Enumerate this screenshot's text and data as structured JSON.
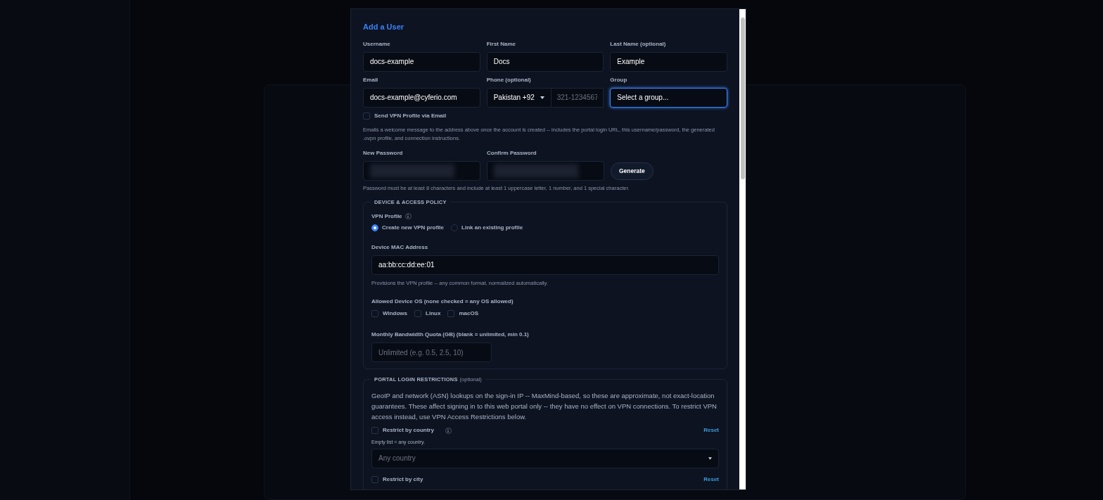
{
  "modal": {
    "title": "Add a User",
    "row1": [
      {
        "label": "Username",
        "value": "docs-example"
      },
      {
        "label": "First Name",
        "value": "Docs"
      },
      {
        "label": "Last Name (optional)",
        "value": "Example"
      }
    ],
    "email": {
      "label": "Email",
      "value": "docs-example@cyferio.com"
    },
    "phone": {
      "label": "Phone (optional)",
      "country": "Pakistan +92",
      "placeholder": "321-1234567"
    },
    "group": {
      "label": "Group",
      "value": "Select a group...",
      "focused": true
    },
    "send_email": {
      "label": "Send VPN Profile via Email",
      "checked": false,
      "help": "Emails a welcome message to the address above once the account is created -- includes the portal login URL, this username/password, the generated .ovpn profile, and connection instructions."
    },
    "passwords": [
      {
        "label": "New Password"
      },
      {
        "label": "Confirm Password"
      }
    ],
    "generate": "Generate",
    "password_help": "Password must be at least 8 characters and include at least 1 uppercase letter, 1 number, and 1 special character.",
    "device_policy": {
      "title": "DEVICE & ACCESS POLICY",
      "vpn_profile_label": "VPN Profile",
      "vpn_options": [
        {
          "label": "Create new VPN profile",
          "selected": true
        },
        {
          "label": "Link an existing profile",
          "selected": false
        }
      ],
      "mac": {
        "label": "Device MAC Address",
        "value": "aa:bb:cc:dd:ee:01",
        "help": "Provisions the VPN profile -- any common format, normalized automatically."
      },
      "os": {
        "label": "Allowed Device OS (none checked = any OS allowed)",
        "options": [
          {
            "label": "Windows",
            "checked": false
          },
          {
            "label": "Linux",
            "checked": false
          },
          {
            "label": "macOS",
            "checked": false
          }
        ]
      },
      "quota": {
        "label": "Monthly Bandwidth Quota (GB) (blank = unlimited, min 0.1)",
        "placeholder": "Unlimited (e.g. 0.5, 2.5, 10)"
      }
    },
    "portal": {
      "title": "PORTAL LOGIN RESTRICTIONS",
      "title_note": "(optional)",
      "description": "GeoIP and network (ASN) lookups on the sign-in IP -- MaxMind-based, so these are approximate, not exact-location guarantees. These affect signing in to this web portal only -- they have no effect on VPN connections. To restrict VPN access instead, use VPN Access Restrictions below.",
      "restrictions": [
        {
          "label": "Restrict by country",
          "checked": false,
          "info": true,
          "reset": "Reset",
          "hint": "Empty list = any country.",
          "placeholder": "Any country"
        },
        {
          "label": "Restrict by city",
          "checked": false,
          "info": false,
          "reset": "Reset"
        }
      ]
    }
  }
}
